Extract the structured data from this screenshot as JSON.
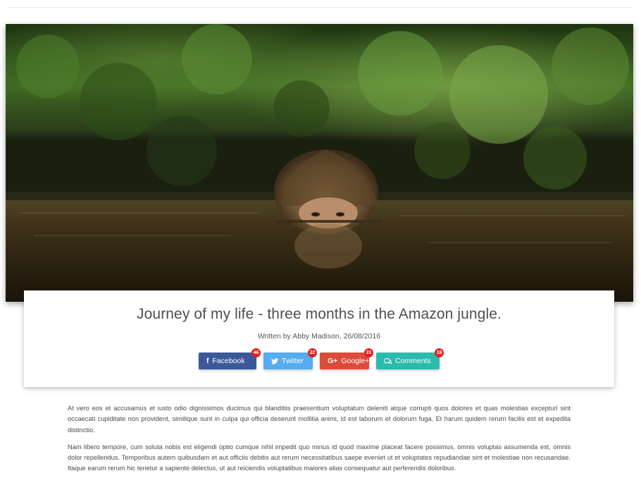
{
  "post": {
    "image": "woman-in-jungle-river-photo",
    "title": "Journey of my life - three months in the Amazon jungle.",
    "byline": "Written by Abby Madison, 26/08/2016"
  },
  "share": {
    "facebook": {
      "label": "Facebook",
      "count": "46",
      "icon": "facebook-icon",
      "color": "#3b5998"
    },
    "twitter": {
      "label": "Twitter",
      "count": "22",
      "icon": "twitter-icon",
      "color": "#55acee"
    },
    "google": {
      "label": "Google+",
      "count": "31",
      "icon": "google-plus-icon",
      "color": "#dd4b39"
    },
    "comments": {
      "label": "Comments",
      "count": "18",
      "icon": "comments-icon",
      "color": "#2bbbad"
    }
  },
  "body": {
    "p1": "At vero eos et accusamus et iusto odio dignissimos ducimus qui blanditiis praesentium voluptatum deleniti atque corrupti quos dolores et quas molestias excepturi sint occaecati cupiditate non provident, similique sunt in culpa qui officia deserunt mollitia animi, id est laborum et dolorum fuga. Et harum quidem rerum facilis est et expedita distinctio.",
    "p2": "Nam libero tempore, cum soluta nobis est eligendi optio cumque nihil impedit quo minus id quod maxime placeat facere possimus, omnis voluptas assumenda est, omnis dolor repellendus. Temporibus autem quibusdam et aut officiis debitis aut rerum necessitatibus saepe eveniet ut et voluptates repudiandae sint et molestiae non recusandae. Itaque earum rerum hic tenetur a sapiente delectus, ut aut reiciendis voluptatibus maiores alias consequatur aut perferendis doloribus."
  }
}
